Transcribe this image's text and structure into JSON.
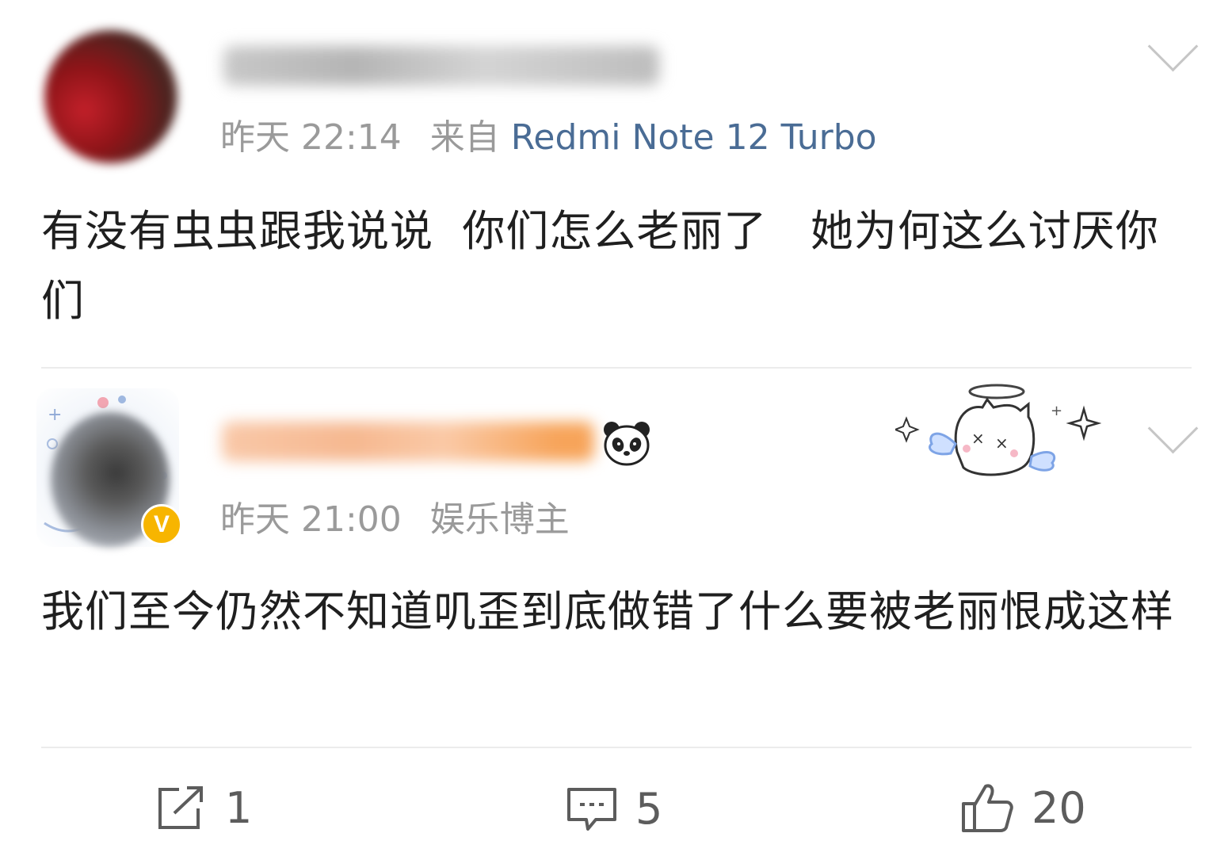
{
  "comments": [
    {
      "time": "昨天 22:14",
      "source_prefix": "来自",
      "device": "Redmi Note 12 Turbo",
      "text": "有没有虫虫跟我说说  你们怎么老丽了   她为何这么讨厌你们",
      "avatar_icon": "user-avatar-blurred",
      "menu_icon": "chevron-down-icon"
    },
    {
      "time": "昨天 21:00",
      "user_tag": "娱乐博主",
      "text": "我们至今仍然不知道叽歪到底做错了什么要被老丽恨成这样",
      "avatar_icon": "user-avatar-blurred",
      "verified_badge": "V",
      "name_emoji": "panda-icon",
      "decoration": "angel-cat-sticker",
      "menu_icon": "chevron-down-icon"
    }
  ],
  "actions": {
    "repost": {
      "icon": "share-icon",
      "count": "1"
    },
    "comment": {
      "icon": "comment-icon",
      "count": "5"
    },
    "like": {
      "icon": "thumbs-up-icon",
      "count": "20"
    }
  },
  "colors": {
    "meta_text": "#9a9a9a",
    "device_link": "#4a6c95",
    "body_text": "#1f1f1f",
    "verified_badge": "#f7b500",
    "divider": "#ececec"
  }
}
